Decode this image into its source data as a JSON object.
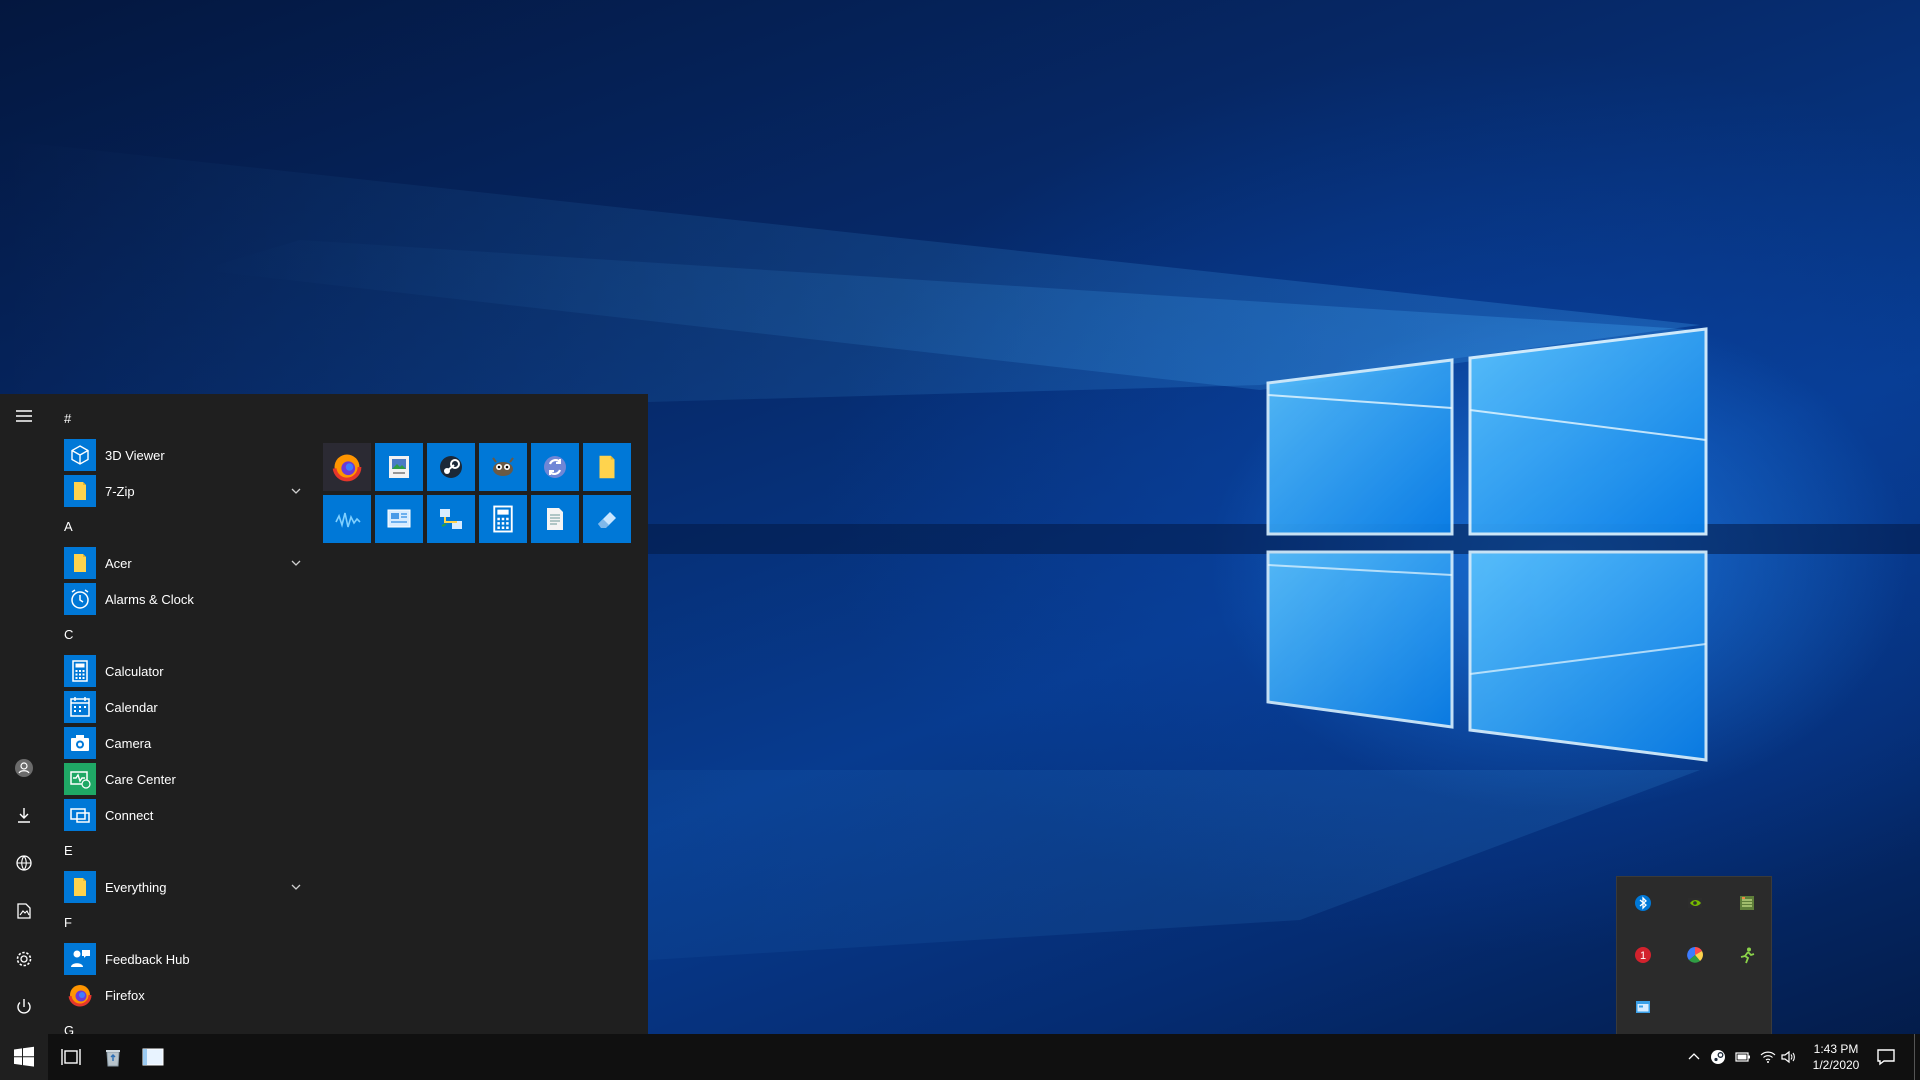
{
  "desktop": {
    "wallpaper": "windows-10-hero"
  },
  "start_menu": {
    "rail": [
      {
        "name": "hamburger-menu-icon"
      },
      {
        "name": "user-account-icon"
      },
      {
        "name": "downloads-icon"
      },
      {
        "name": "network-icon"
      },
      {
        "name": "pictures-icon"
      },
      {
        "name": "settings-gear-icon"
      },
      {
        "name": "power-icon"
      }
    ],
    "groups": [
      {
        "letter": "#",
        "apps": [
          {
            "label": "3D Viewer",
            "icon": "3d-viewer-icon",
            "expandable": false
          },
          {
            "label": "7-Zip",
            "icon": "folder-icon",
            "expandable": true
          }
        ]
      },
      {
        "letter": "A",
        "apps": [
          {
            "label": "Acer",
            "icon": "folder-icon",
            "expandable": true
          },
          {
            "label": "Alarms & Clock",
            "icon": "alarm-clock-icon",
            "expandable": false
          }
        ]
      },
      {
        "letter": "C",
        "apps": [
          {
            "label": "Calculator",
            "icon": "calculator-icon",
            "expandable": false
          },
          {
            "label": "Calendar",
            "icon": "calendar-icon",
            "expandable": false
          },
          {
            "label": "Camera",
            "icon": "camera-icon",
            "expandable": false
          },
          {
            "label": "Care Center",
            "icon": "care-center-icon",
            "expandable": false
          },
          {
            "label": "Connect",
            "icon": "connect-icon",
            "expandable": false
          }
        ]
      },
      {
        "letter": "E",
        "apps": [
          {
            "label": "Everything",
            "icon": "folder-icon",
            "expandable": true
          }
        ]
      },
      {
        "letter": "F",
        "apps": [
          {
            "label": "Feedback Hub",
            "icon": "feedback-hub-icon",
            "expandable": false
          },
          {
            "label": "Firefox",
            "icon": "firefox-icon",
            "expandable": false
          }
        ]
      },
      {
        "letter": "G",
        "apps": []
      }
    ],
    "tiles": [
      {
        "icon": "firefox-icon"
      },
      {
        "icon": "image-editor-icon"
      },
      {
        "icon": "steam-icon"
      },
      {
        "icon": "gimp-icon"
      },
      {
        "icon": "sync-app-icon"
      },
      {
        "icon": "folder-icon"
      },
      {
        "icon": "audio-waveform-icon"
      },
      {
        "icon": "control-panel-icon"
      },
      {
        "icon": "network-connections-icon"
      },
      {
        "icon": "calculator-icon"
      },
      {
        "icon": "notepad-icon"
      },
      {
        "icon": "eraser-icon"
      }
    ]
  },
  "tray_overflow": [
    {
      "icon": "bluetooth-icon"
    },
    {
      "icon": "nvidia-icon"
    },
    {
      "icon": "hardware-monitor-icon"
    },
    {
      "icon": "alert-badge-icon",
      "badge": "1"
    },
    {
      "icon": "color-wheel-icon"
    },
    {
      "icon": "green-runner-icon"
    },
    {
      "icon": "app-window-icon"
    }
  ],
  "taskbar": {
    "pinned": [
      {
        "name": "task-view-button"
      },
      {
        "name": "recycle-bin-button"
      },
      {
        "name": "explorer-window-button"
      }
    ],
    "tray": [
      {
        "name": "show-hidden-icons-chevron-icon"
      },
      {
        "name": "steam-tray-icon"
      },
      {
        "name": "battery-icon"
      },
      {
        "name": "wifi-icon"
      },
      {
        "name": "volume-icon"
      }
    ],
    "time": "1:43 PM",
    "date": "1/2/2020"
  }
}
